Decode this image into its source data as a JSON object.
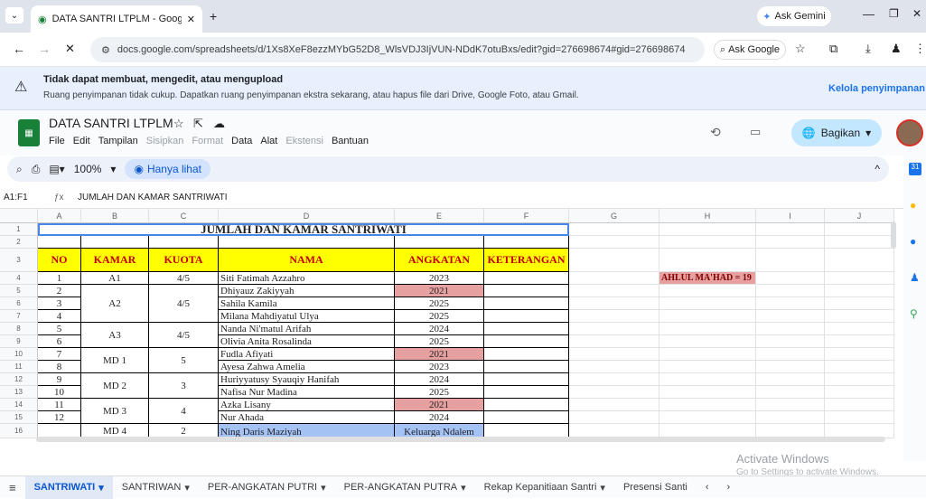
{
  "browser": {
    "tab_title": "DATA SANTRI LTPLM - Google S",
    "url": "docs.google.com/spreadsheets/d/1Xs8XeF8ezzMYbG52D8_WlsVDJ3IjVUN-NDdK7otuBxs/edit?gid=276698674#gid=276698674",
    "ask_gemini": "Ask Gemini",
    "ask_google": "Ask Google"
  },
  "banner": {
    "title": "Tidak dapat membuat, mengedit, atau mengupload",
    "message": "Ruang penyimpanan tidak cukup. Dapatkan ruang penyimpanan ekstra sekarang, atau hapus file dari Drive, Google Foto, atau Gmail.",
    "action": "Kelola penyimpanan"
  },
  "doc": {
    "title": "DATA SANTRI LTPLM",
    "menus": [
      "File",
      "Edit",
      "Tampilan",
      "Sisipkan",
      "Format",
      "Data",
      "Alat",
      "Ekstensi",
      "Bantuan"
    ],
    "share": "Bagikan"
  },
  "toolbar": {
    "zoom": "100%",
    "view_only": "Hanya lihat"
  },
  "formula": {
    "ref": "A1:F1",
    "content": "JUMLAH DAN KAMAR SANTRIWATI"
  },
  "columns": [
    "A",
    "B",
    "C",
    "D",
    "E",
    "F",
    "G",
    "H",
    "I",
    "J"
  ],
  "rows": [
    "1",
    "2",
    "3",
    "4",
    "5",
    "6",
    "7",
    "8",
    "9",
    "10",
    "11",
    "12",
    "13",
    "14",
    "15",
    "16"
  ],
  "sheet": {
    "title": "JUMLAH DAN KAMAR SANTRIWATI",
    "headers": [
      "NO",
      "KAMAR",
      "KUOTA",
      "NAMA",
      "ANGKATAN",
      "KETERANGAN"
    ],
    "note": "AHLUL MA'HAD = 19",
    "entries": [
      {
        "no": "1",
        "nama": "Siti Fatimah Azzahro",
        "angkatan": "2023"
      },
      {
        "no": "2",
        "nama": "Dhiyauz Zakiyyah",
        "angkatan": "2021"
      },
      {
        "no": "3",
        "nama": "Sahila Kamila",
        "angkatan": "2025"
      },
      {
        "no": "4",
        "nama": "Milana Mahdiyatul Ulya",
        "angkatan": "2025"
      },
      {
        "no": "5",
        "nama": "Nanda Ni'matul Arifah",
        "angkatan": "2024"
      },
      {
        "no": "6",
        "nama": "Olivia Anita Rosalinda",
        "angkatan": "2025"
      },
      {
        "no": "7",
        "nama": "Fudla Afiyati",
        "angkatan": "2021"
      },
      {
        "no": "8",
        "nama": "Ayesa Zahwa Amelia",
        "angkatan": "2023"
      },
      {
        "no": "9",
        "nama": "Huriyyatusy Syauqiy Hanifah",
        "angkatan": "2024"
      },
      {
        "no": "10",
        "nama": "Nafisa Nur Madina",
        "angkatan": "2025"
      },
      {
        "no": "11",
        "nama": "Azka Lisany",
        "angkatan": "2021"
      },
      {
        "no": "12",
        "nama": "Nur Ahada",
        "angkatan": "2024"
      },
      {
        "no": "",
        "nama": "Ning Daris Maziyah",
        "angkatan": "Keluarga Ndalem"
      }
    ],
    "kamar": [
      {
        "kamar": "A1",
        "kuota": "4/5"
      },
      {
        "kamar": "A2",
        "kuota": "4/5"
      },
      {
        "kamar": "A3",
        "kuota": "4/5"
      },
      {
        "kamar": "MD 1",
        "kuota": "5"
      },
      {
        "kamar": "MD 2",
        "kuota": "3"
      },
      {
        "kamar": "MD 3",
        "kuota": "4"
      },
      {
        "kamar": "MD 4",
        "kuota": "2"
      }
    ]
  },
  "tabs": [
    "SANTRIWATI",
    "SANTRIWAN",
    "PER-ANGKATAN PUTRI",
    "PER-ANGKATAN PUTRA",
    "Rekap Kepanitiaan Santri",
    "Presensi Santi"
  ],
  "watermark": {
    "line1": "Activate Windows",
    "line2": "Go to Settings to activate Windows."
  },
  "colors": {
    "header_yellow": "#ffff00",
    "pink": "#e6a0a0",
    "blue": "#a4c2f4"
  }
}
